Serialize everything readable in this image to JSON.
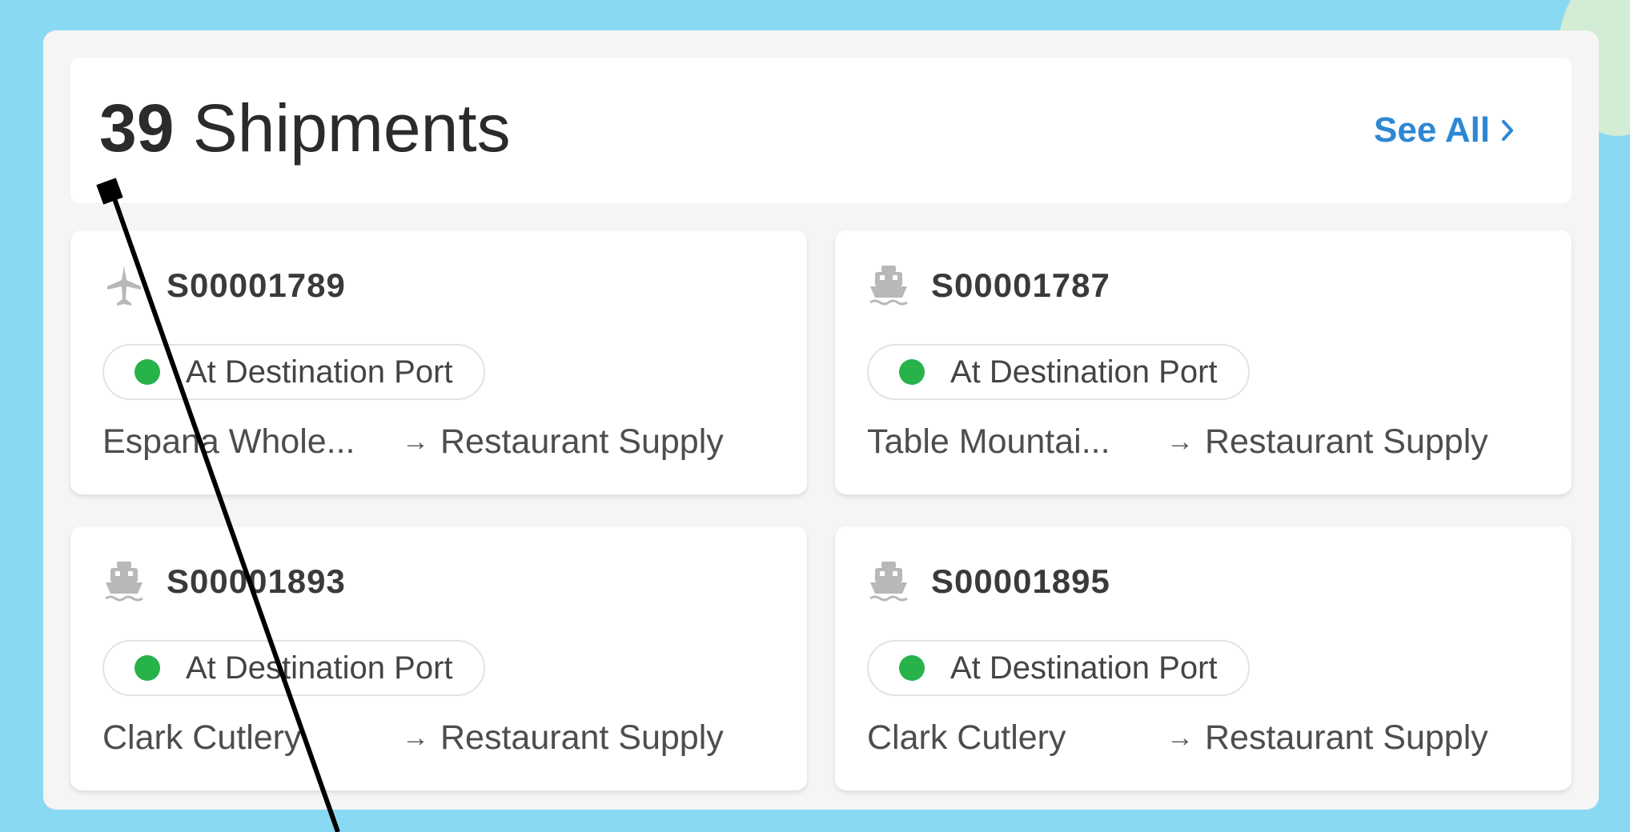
{
  "header": {
    "count": "39",
    "title_suffix": "Shipments",
    "see_all_label": "See All"
  },
  "shipments": [
    {
      "id": "S00001789",
      "mode_icon": "plane-icon",
      "status": "At Destination Port",
      "from": "Espana Whole...",
      "to": "Restaurant Supply"
    },
    {
      "id": "S00001787",
      "mode_icon": "ship-icon",
      "status": "At Destination Port",
      "from": "Table Mountai...",
      "to": "Restaurant Supply"
    },
    {
      "id": "S00001893",
      "mode_icon": "ship-icon",
      "status": "At Destination Port",
      "from": "Clark Cutlery",
      "to": "Restaurant Supply"
    },
    {
      "id": "S00001895",
      "mode_icon": "ship-icon",
      "status": "At Destination Port",
      "from": "Clark Cutlery",
      "to": "Restaurant Supply"
    }
  ],
  "colors": {
    "background": "#8ad9f3",
    "accent": "#2d87d3",
    "status_green": "#27b24a"
  }
}
